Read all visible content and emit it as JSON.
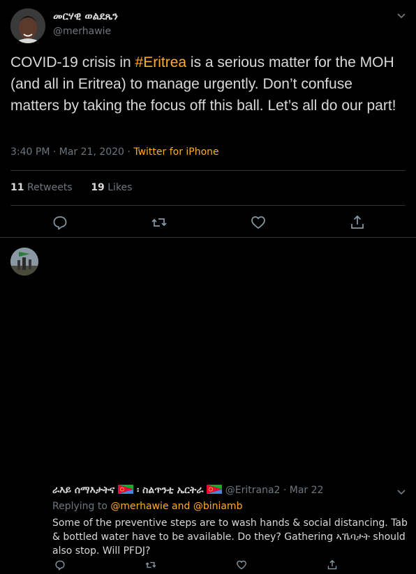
{
  "tweet": {
    "author_name": "መርሃዊ ወልደጼን",
    "author_handle": "@merhawie",
    "text_before": "COVID-19 crisis in ",
    "hashtag": "#Eritrea",
    "text_after": " is a serious matter for the MOH (and all in Eritrea) to manage urgently. Don’t confuse matters by taking the focus off this ball. Let’s all do our part!",
    "time": "3:40 PM · Mar 21, 2020 · ",
    "source": "Twitter for iPhone",
    "retweets_count": "11",
    "retweets_label": "Retweets",
    "likes_count": "19",
    "likes_label": "Likes"
  },
  "reply": {
    "name_part1": "ራእይ ሰማእታትና",
    "name_sep": " ፡ ",
    "name_part2": "ስልጥንቲ ኤርትራ",
    "handle": "@Eritrana2 · Mar 22",
    "replying_prefix": "Replying to ",
    "mention1": "@merhawie",
    "and": " and ",
    "mention2": "@biniamb",
    "text": "Some of the preventive steps are to wash hands & social distancing. Tab & bottled water have to be available. Do they? Gathering  ኣኼባታት should also stop. Will PFDJ?"
  },
  "colors": {
    "accent": "#ffad1f",
    "muted": "#6e767d",
    "text": "#d9d9d9",
    "divider": "#2f3336"
  },
  "icons": {
    "more": "chevron-down-icon",
    "reply": "comment-icon",
    "retweet": "retweet-icon",
    "like": "heart-icon",
    "share": "share-icon",
    "flag": "eritrea-flag-icon"
  }
}
